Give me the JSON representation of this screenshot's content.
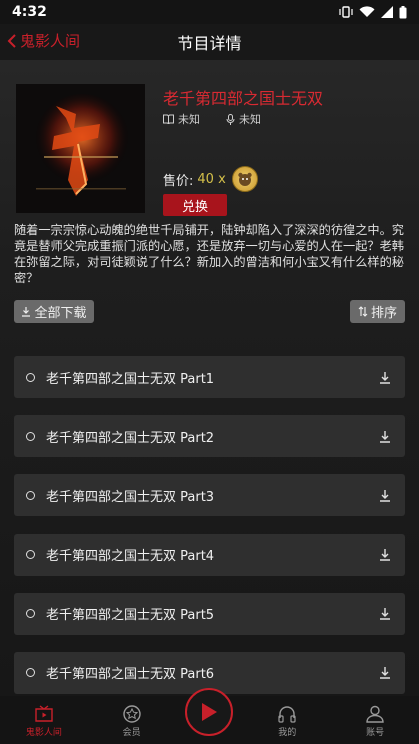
{
  "status_bar": {
    "time": "4:32"
  },
  "header": {
    "back_label": "鬼影人间",
    "title": "节目详情"
  },
  "program": {
    "title": "老千第四部之国士无双",
    "author": "未知",
    "narrator": "未知",
    "price_label": "售价:",
    "price_value": "40 x",
    "exchange_label": "兑换",
    "description": "随着一宗宗惊心动魄的绝世千局铺开，陆钟却陷入了深深的彷徨之中。究竟是替师父完成重振门派的心愿，还是放弃一切与心爱的人在一起？老韩在弥留之际，对司徒颖说了什么？新加入的曾洁和何小宝又有什么样的秘密？"
  },
  "actions": {
    "download_all": "全部下载",
    "sort": "排序"
  },
  "episodes": [
    {
      "title": "老千第四部之国士无双 Part1"
    },
    {
      "title": "老千第四部之国士无双 Part2"
    },
    {
      "title": "老千第四部之国士无双 Part3"
    },
    {
      "title": "老千第四部之国士无双 Part4"
    },
    {
      "title": "老千第四部之国士无双 Part5"
    },
    {
      "title": "老千第四部之国士无双 Part6"
    }
  ],
  "tabbar": {
    "tabs": [
      {
        "label": "鬼影人间",
        "icon": "play-frame-icon",
        "active": true
      },
      {
        "label": "会员",
        "icon": "member-badge-icon",
        "active": false
      },
      {
        "label": "我的",
        "icon": "headphones-icon",
        "active": false
      },
      {
        "label": "账号",
        "icon": "person-icon",
        "active": false
      }
    ]
  },
  "colors": {
    "accent": "#c8202a",
    "title_red": "#d82a32",
    "price_gold": "#d4c04a"
  }
}
